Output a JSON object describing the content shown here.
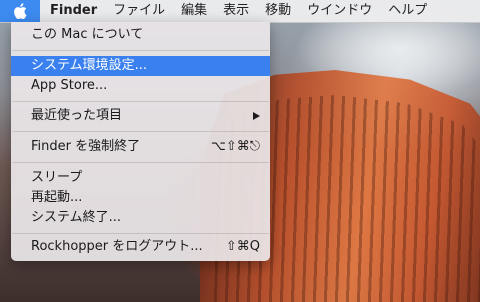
{
  "menubar": {
    "app_name": "Finder",
    "items": [
      "ファイル",
      "編集",
      "表示",
      "移動",
      "ウインドウ",
      "ヘルプ"
    ]
  },
  "apple_menu": {
    "about": "この Mac について",
    "system_preferences": "システム環境設定...",
    "app_store": "App Store...",
    "recent_items": "最近使った項目",
    "force_quit": {
      "label": "Finder を強制終了",
      "shortcut": "⌥⇧⌘⎋"
    },
    "sleep": "スリープ",
    "restart": "再起動...",
    "shutdown": "システム終了...",
    "logout": {
      "label": "Rockhopper をログアウト...",
      "shortcut": "⇧⌘Q"
    }
  },
  "colors": {
    "highlight": "#3a80ee",
    "apple_active_bg": "#3d8bf0"
  }
}
